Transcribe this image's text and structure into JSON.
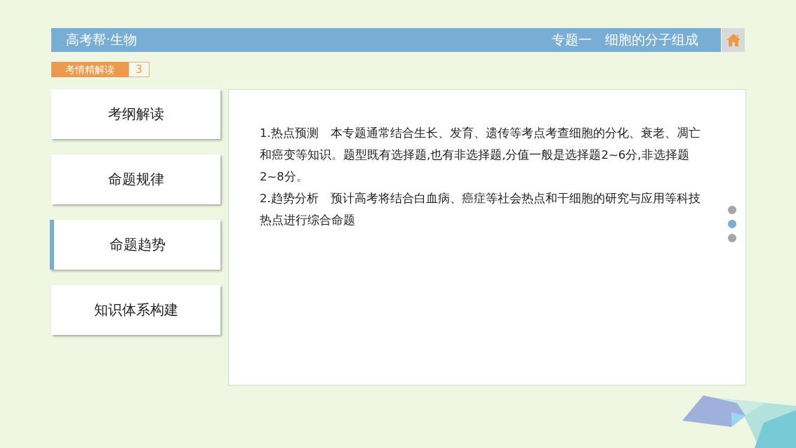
{
  "header": {
    "title": "高考帮·生物",
    "topic": "专题一　细胞的分子组成"
  },
  "section_tag": {
    "label": "考情精解读",
    "number": "3"
  },
  "nav": [
    {
      "label": "考纲解读",
      "selected": false
    },
    {
      "label": "命题规律",
      "selected": false
    },
    {
      "label": "命题趋势",
      "selected": true
    },
    {
      "label": "知识体系构建",
      "selected": false
    }
  ],
  "content": {
    "paragraphs": [
      "1.热点预测　本专题通常结合生长、发育、遗传等考点考查细胞的分化、衰老、凋亡和癌变等知识。题型既有选择题,也有非选择题,分值一般是选择题2~6分,非选择题2~8分。",
      "2.趋势分析　预计高考将结合白血病、癌症等社会热点和干细胞的研究与应用等科技热点进行综合命题"
    ]
  },
  "pager": [
    {
      "selected": false
    },
    {
      "selected": true
    },
    {
      "selected": false
    }
  ]
}
